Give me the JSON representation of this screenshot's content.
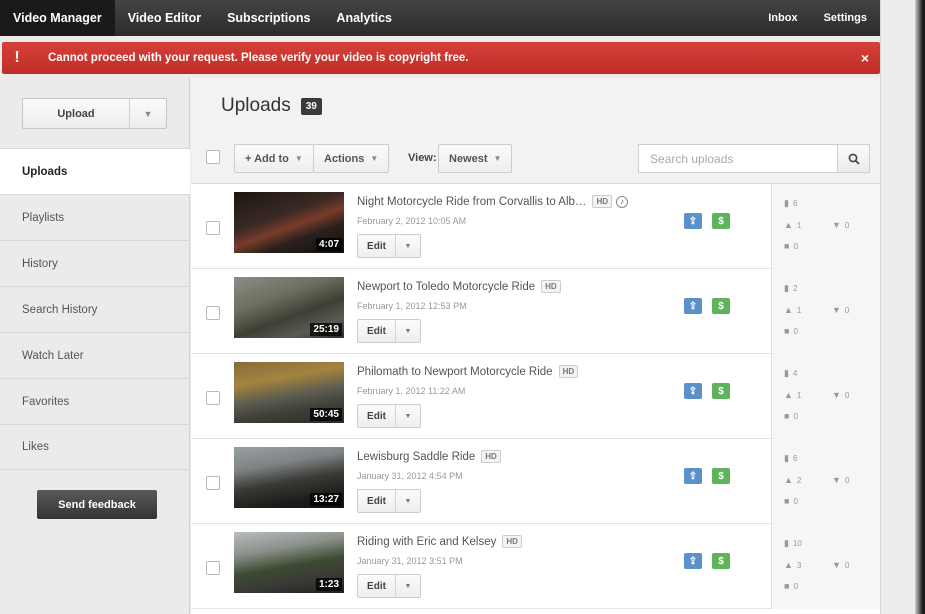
{
  "nav": {
    "items": [
      "Video Manager",
      "Video Editor",
      "Subscriptions",
      "Analytics"
    ],
    "right": [
      "Inbox",
      "Settings"
    ]
  },
  "alert": {
    "icon": "!",
    "text": "Cannot proceed with your request. Please verify your video is copyright free.",
    "close": "×"
  },
  "sidebar": {
    "upload_label": "Upload",
    "items": [
      "Uploads",
      "Playlists",
      "History",
      "Search History",
      "Watch Later",
      "Favorites",
      "Likes"
    ],
    "feedback_label": "Send feedback"
  },
  "header": {
    "title": "Uploads",
    "count": "39"
  },
  "toolbar": {
    "add_to": "+ Add to",
    "actions": "Actions",
    "view_label": "View:",
    "view_value": "Newest",
    "search_placeholder": "Search uploads"
  },
  "videos": [
    {
      "title": "Night Motorcycle Ride from Corvallis to Alb…",
      "hd": "HD",
      "music": "♪",
      "date": "February 2, 2012 10:05 AM",
      "duration": "4:07",
      "edit": "Edit",
      "views": "6",
      "likes": "1",
      "dislikes": "0",
      "comments": "0"
    },
    {
      "title": "Newport to Toledo Motorcycle Ride",
      "hd": "HD",
      "date": "February 1, 2012 12:53 PM",
      "duration": "25:19",
      "edit": "Edit",
      "views": "2",
      "likes": "1",
      "dislikes": "0",
      "comments": "0"
    },
    {
      "title": "Philomath to Newport Motorcycle Ride",
      "hd": "HD",
      "date": "February 1, 2012 11:22 AM",
      "duration": "50:45",
      "edit": "Edit",
      "views": "4",
      "likes": "1",
      "dislikes": "0",
      "comments": "0"
    },
    {
      "title": "Lewisburg Saddle Ride",
      "hd": "HD",
      "date": "January 31, 2012 4:54 PM",
      "duration": "13:27",
      "edit": "Edit",
      "views": "6",
      "likes": "2",
      "dislikes": "0",
      "comments": "0"
    },
    {
      "title": "Riding with Eric and Kelsey",
      "hd": "HD",
      "date": "January 31, 2012 3:51 PM",
      "duration": "1:23",
      "edit": "Edit",
      "views": "10",
      "likes": "3",
      "dislikes": "0",
      "comments": "0"
    }
  ],
  "badges": {
    "blue_icon": "⇪",
    "green_icon": "$"
  }
}
